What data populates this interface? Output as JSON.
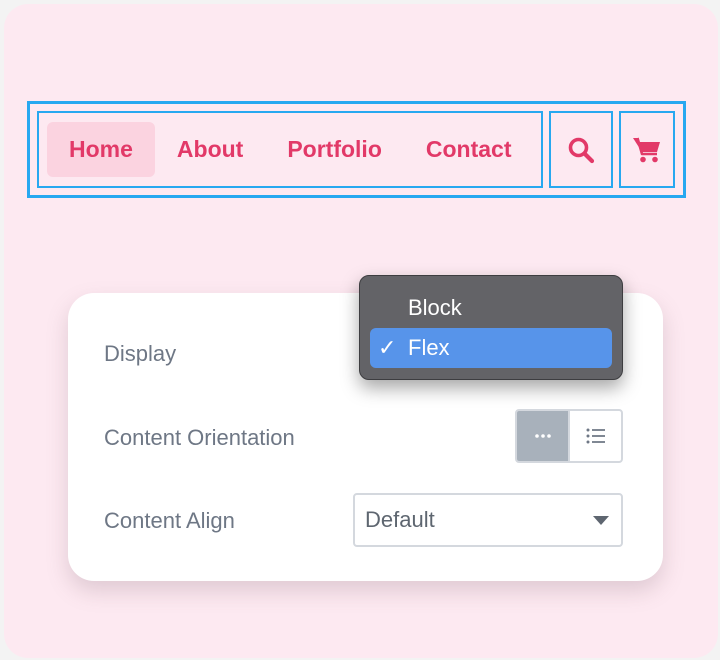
{
  "nav": {
    "items": [
      {
        "label": "Home",
        "active": true
      },
      {
        "label": "About",
        "active": false
      },
      {
        "label": "Portfolio",
        "active": false
      },
      {
        "label": "Contact",
        "active": false
      }
    ],
    "icons": [
      "search-icon",
      "cart-icon"
    ],
    "accent_color": "#e23968",
    "outline_color": "#27a8f0"
  },
  "settings": {
    "display": {
      "label": "Display",
      "options": [
        "Block",
        "Flex"
      ],
      "selected": "Flex"
    },
    "content_orientation": {
      "label": "Content Orientation",
      "options": [
        "horizontal-dots-icon",
        "vertical-list-icon"
      ],
      "selected": "horizontal-dots-icon"
    },
    "content_align": {
      "label": "Content Align",
      "value": "Default"
    }
  },
  "popup": {
    "checkmark": "✓",
    "highlight_color": "#5794ea"
  }
}
